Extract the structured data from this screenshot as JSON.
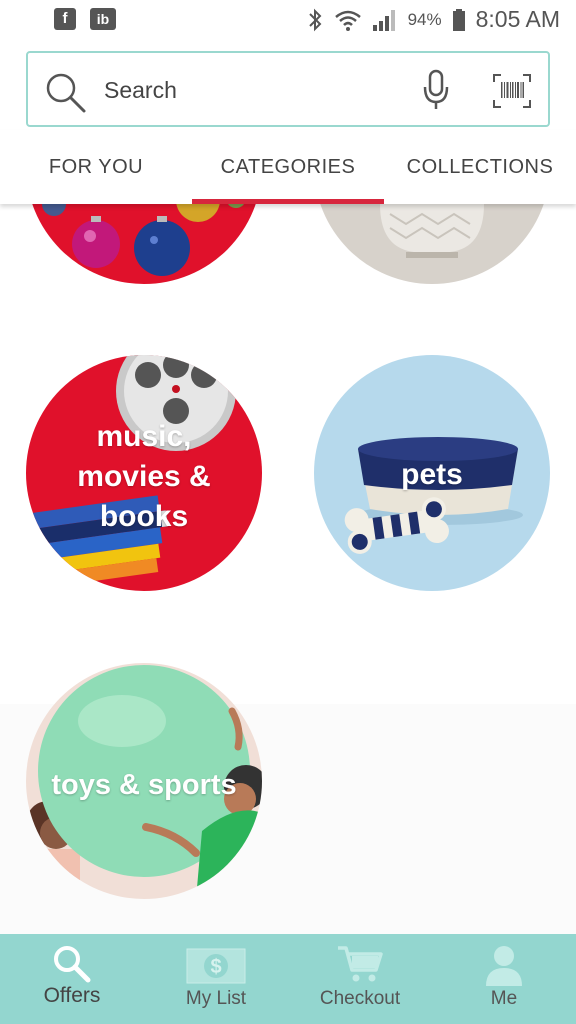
{
  "status_bar": {
    "left_apps": [
      "f",
      "ib"
    ],
    "battery": "94%",
    "time": "8:05 AM"
  },
  "search": {
    "placeholder": "Search"
  },
  "tabs": [
    {
      "label": "FOR YOU",
      "active": false
    },
    {
      "label": "CATEGORIES",
      "active": true
    },
    {
      "label": "COLLECTIONS",
      "active": false
    }
  ],
  "categories": [
    {
      "name": "holiday",
      "label_lines": []
    },
    {
      "name": "home",
      "label_lines": []
    },
    {
      "name": "music-movies-books",
      "label_lines": [
        "music,",
        "movies &",
        "books"
      ]
    },
    {
      "name": "pets",
      "label_lines": [
        "pets"
      ]
    },
    {
      "name": "toys-sports",
      "label_lines": [
        "toys & sports"
      ]
    }
  ],
  "bottom_nav": [
    {
      "label": "Offers",
      "icon": "search-icon",
      "active": true
    },
    {
      "label": "My List",
      "icon": "dollar-list-icon",
      "active": false
    },
    {
      "label": "Checkout",
      "icon": "cart-icon",
      "active": false
    },
    {
      "label": "Me",
      "icon": "person-icon",
      "active": false
    }
  ],
  "colors": {
    "accent": "#d7263d",
    "teal": "#93d6cf",
    "search_border": "#9ad8cf"
  }
}
